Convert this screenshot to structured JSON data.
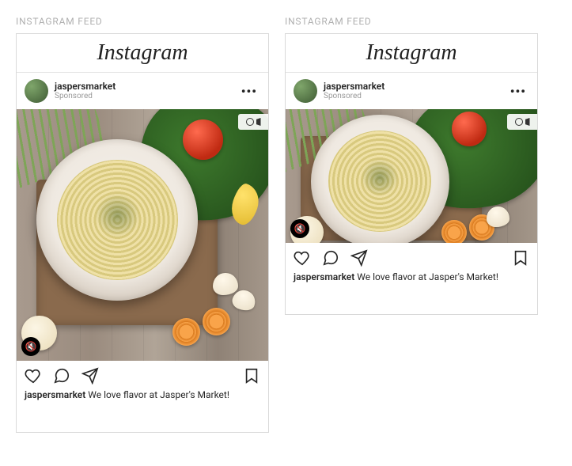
{
  "section_label": "INSTAGRAM FEED",
  "brand": "Instagram",
  "posts": [
    {
      "username": "jaspersmarket",
      "sponsored_label": "Sponsored",
      "caption_user": "jaspersmarket",
      "caption_text": "We love flavor at Jasper's Market!",
      "media_aspect": "square",
      "has_mute": true,
      "has_camera_badge": true
    },
    {
      "username": "jaspersmarket",
      "sponsored_label": "Sponsored",
      "caption_user": "jaspersmarket",
      "caption_text": "We love flavor at Jasper's Market!",
      "media_aspect": "wide",
      "has_mute": true,
      "has_camera_badge": true
    }
  ],
  "icons": {
    "more": "•••",
    "mute": "🔇"
  }
}
